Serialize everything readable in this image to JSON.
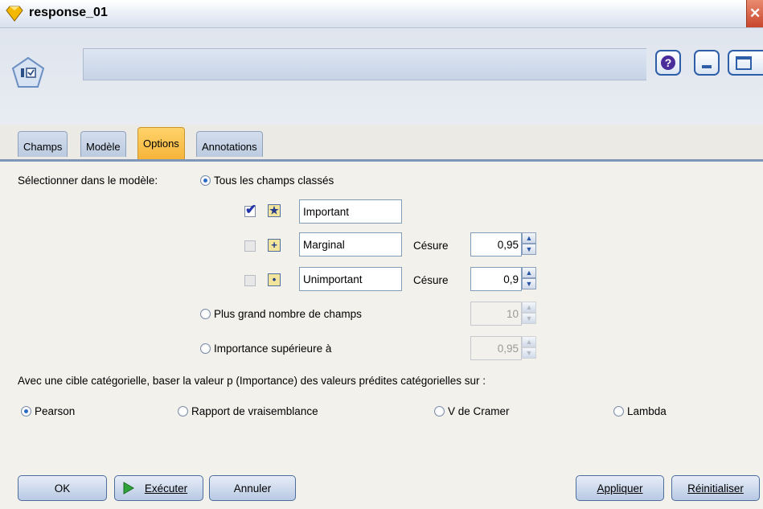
{
  "window": {
    "title": "response_01"
  },
  "tabs": [
    {
      "label": "Champs"
    },
    {
      "label": "Modèle"
    },
    {
      "label": "Options"
    },
    {
      "label": "Annotations"
    }
  ],
  "options": {
    "select_label": "Sélectionner dans le modèle:",
    "radio_all_ranked": "Tous les champs classés",
    "rows": [
      {
        "label": "Important",
        "checked": true
      },
      {
        "label": "Marginal",
        "checked": false,
        "cutoff_label": "Césure",
        "cutoff_value": "0,95"
      },
      {
        "label": "Unimportant",
        "checked": false,
        "cutoff_label": "Césure",
        "cutoff_value": "0,9"
      }
    ],
    "radio_top_n": "Plus grand nombre de champs",
    "top_n_value": "10",
    "radio_importance_above": "Importance supérieure à",
    "importance_value": "0,95",
    "categorical_note": "Avec une cible catégorielle, baser la valeur p (Importance) des valeurs prédites catégorielles sur :",
    "methods": [
      "Pearson",
      "Rapport de vraisemblance",
      "V de Cramer",
      "Lambda"
    ]
  },
  "buttons": {
    "ok": "OK",
    "run": "Exécuter",
    "cancel": "Annuler",
    "apply": "Appliquer",
    "reset": "Réinitialiser"
  }
}
